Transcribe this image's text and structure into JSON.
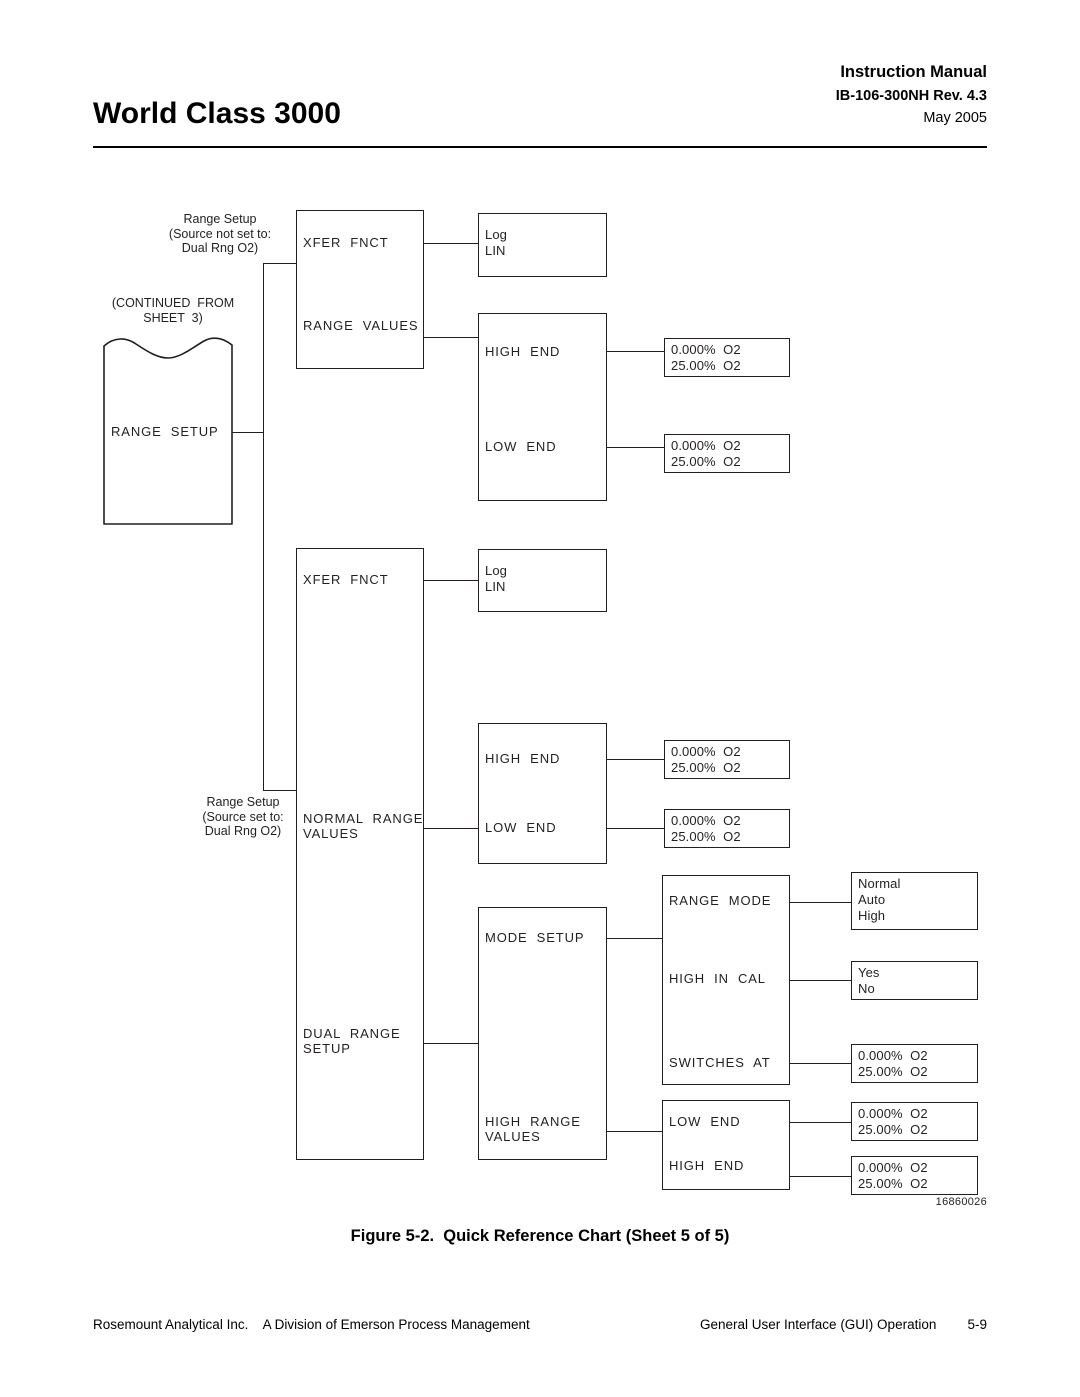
{
  "header": {
    "product_title": "World Class 3000",
    "manual_label": "Instruction Manual",
    "doc_number": "IB-106-300NH Rev. 4.3",
    "date": "May 2005"
  },
  "figure": {
    "caption": "Figure 5-2.  Quick Reference Chart (Sheet 5 of 5)",
    "drawing_number": "16860026"
  },
  "footer": {
    "company": "Rosemount Analytical Inc.    A Division of Emerson Process Management",
    "section": "General User Interface (GUI) Operation",
    "page": "5-9"
  },
  "diagram": {
    "notes": {
      "source_not_dual": "Range Setup\n(Source not set to:\nDual Rng O2)",
      "continued_from": "(CONTINUED  FROM\nSHEET  3)",
      "source_dual": "Range Setup\n(Source set to:\nDual Rng O2)"
    },
    "root": {
      "label": "RANGE  SETUP"
    },
    "branch_single": {
      "menu_items": [
        {
          "label": "XFER  FNCT"
        },
        {
          "label": "RANGE  VALUES"
        }
      ],
      "xfer_options": "Log\nLIN",
      "range_values": {
        "items": [
          {
            "label": "HIGH  END"
          },
          {
            "label": "LOW  END"
          }
        ],
        "high_end_value": "0.000%  O2\n25.00%  O2",
        "low_end_value": "0.000%  O2\n25.00%  O2"
      }
    },
    "branch_dual": {
      "menu_items": [
        {
          "label": "XFER  FNCT"
        },
        {
          "label": "NORMAL  RANGE\nVALUES"
        },
        {
          "label": "DUAL  RANGE\nSETUP"
        }
      ],
      "xfer_options": "Log\nLIN",
      "normal_range_values": {
        "items": [
          {
            "label": "HIGH  END"
          },
          {
            "label": "LOW  END"
          }
        ],
        "high_end_value": "0.000%  O2\n25.00%  O2",
        "low_end_value": "0.000%  O2\n25.00%  O2"
      },
      "dual_range_setup": {
        "items": [
          {
            "label": "MODE  SETUP"
          },
          {
            "label": "HIGH  RANGE\nVALUES"
          }
        ],
        "mode_setup": {
          "items": [
            {
              "label": "RANGE  MODE"
            },
            {
              "label": "HIGH  IN  CAL"
            },
            {
              "label": "SWITCHES  AT"
            }
          ],
          "range_mode_options": "Normal\nAuto\nHigh",
          "high_in_cal_options": "Yes\nNo",
          "switches_at_value": "0.000%  O2\n25.00%  O2"
        },
        "high_range_values": {
          "items": [
            {
              "label": "LOW  END"
            },
            {
              "label": "HIGH  END"
            }
          ],
          "low_end_value": "0.000%  O2\n25.00%  O2",
          "high_end_value": "0.000%  O2\n25.00%  O2"
        }
      }
    }
  }
}
